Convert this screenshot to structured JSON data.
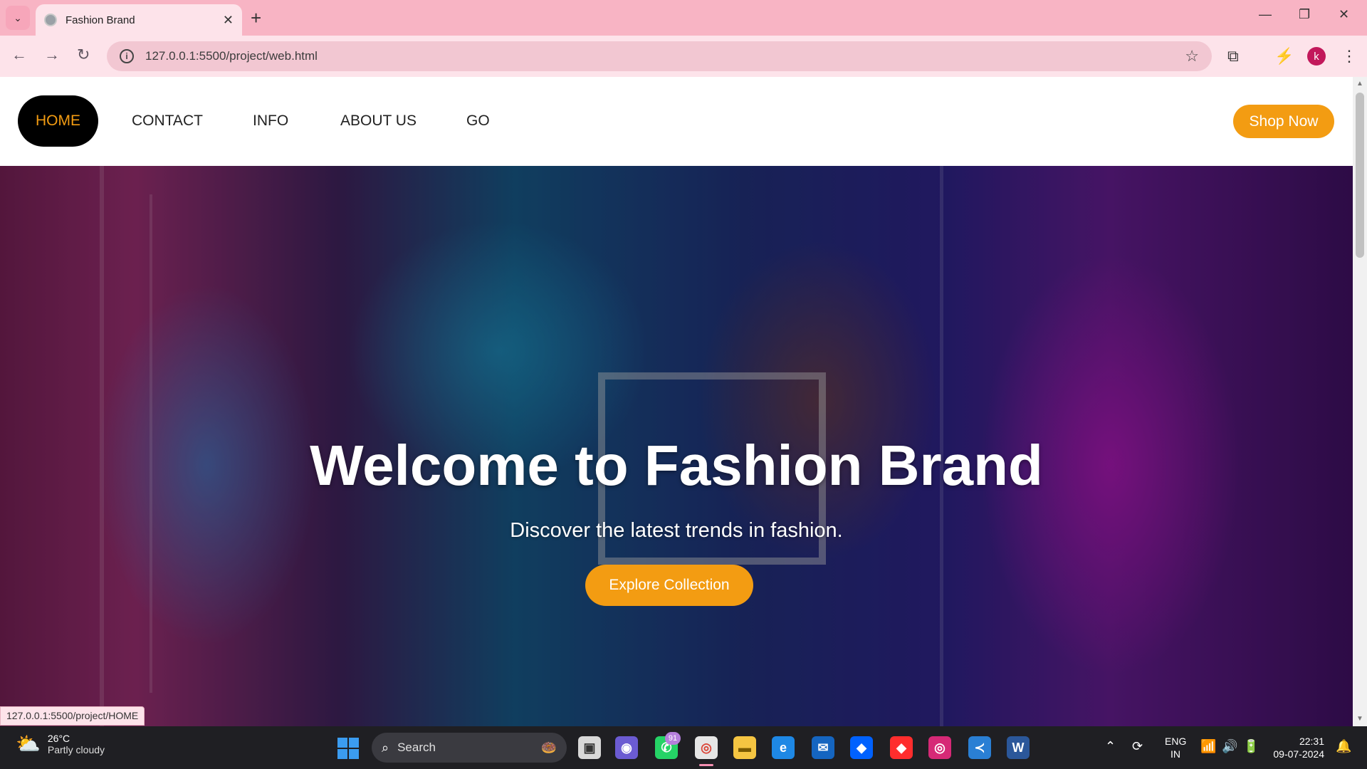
{
  "browser": {
    "tab_title": "Fashion Brand",
    "url": "127.0.0.1:5500/project/web.html",
    "profile_initial": "k",
    "status_url": "127.0.0.1:5500/project/HOME"
  },
  "site": {
    "nav": [
      "HOME",
      "CONTACT",
      "INFO",
      "ABOUT US",
      "GO"
    ],
    "shop_button": "Shop Now",
    "hero": {
      "title": "Welcome to Fashion Brand",
      "subtitle": "Discover the latest trends in fashion.",
      "cta": "Explore Collection"
    }
  },
  "taskbar": {
    "weather_temp": "26°C",
    "weather_cond": "Partly cloudy",
    "search_label": "Search",
    "whatsapp_badge": "91",
    "lang_top": "ENG",
    "lang_bottom": "IN",
    "time": "22:31",
    "date": "09-07-2024"
  },
  "colors": {
    "accent": "#f39c12",
    "chrome": "#f8b4c4",
    "nav_active_bg": "#000000"
  }
}
